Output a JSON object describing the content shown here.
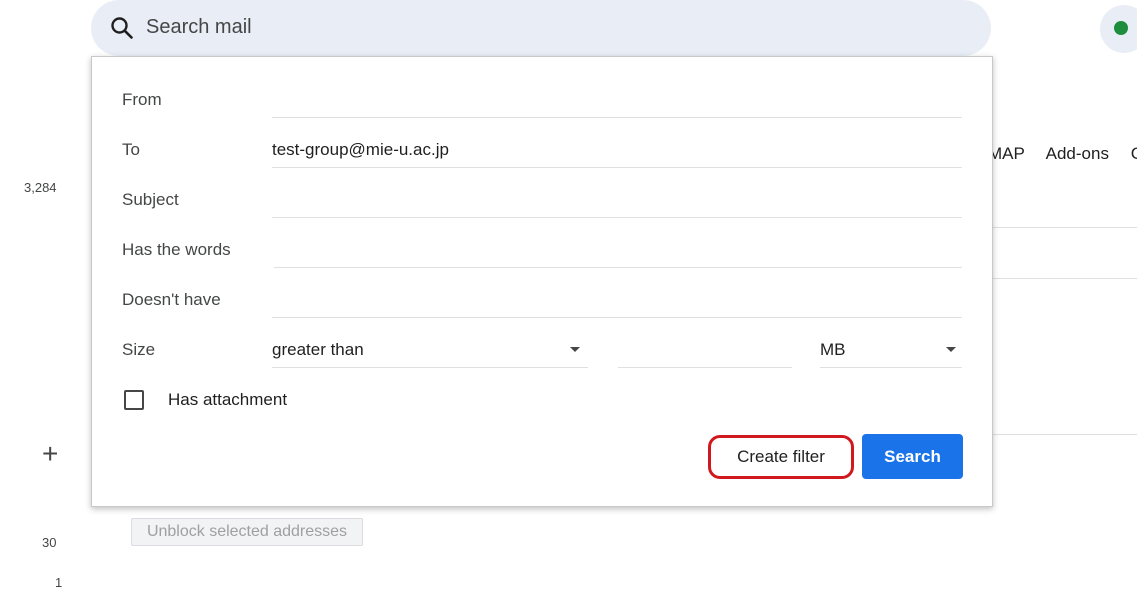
{
  "search": {
    "placeholder": "Search mail"
  },
  "rail": {
    "counts": [
      "3,284",
      "30",
      "1"
    ]
  },
  "tabs_peek": {
    "items": [
      "MAP",
      "Add-ons",
      "C"
    ]
  },
  "background": {
    "unblock_label": "Unblock selected addresses"
  },
  "filter_panel": {
    "fields": [
      {
        "label": "From",
        "value": ""
      },
      {
        "label": "To",
        "value": "test-group@mie-u.ac.jp"
      },
      {
        "label": "Subject",
        "value": ""
      },
      {
        "label": "Has the words",
        "value": ""
      },
      {
        "label": "Doesn't have",
        "value": ""
      }
    ],
    "size": {
      "label": "Size",
      "comparator": "greater than",
      "value": "",
      "unit": "MB"
    },
    "has_attachment": {
      "label": "Has attachment",
      "checked": false
    },
    "create_filter_label": "Create filter",
    "search_label": "Search"
  },
  "colors": {
    "primary_button": "#1a73e8",
    "highlight_outline": "#d0191e",
    "status_dot": "#1e8e3e"
  }
}
